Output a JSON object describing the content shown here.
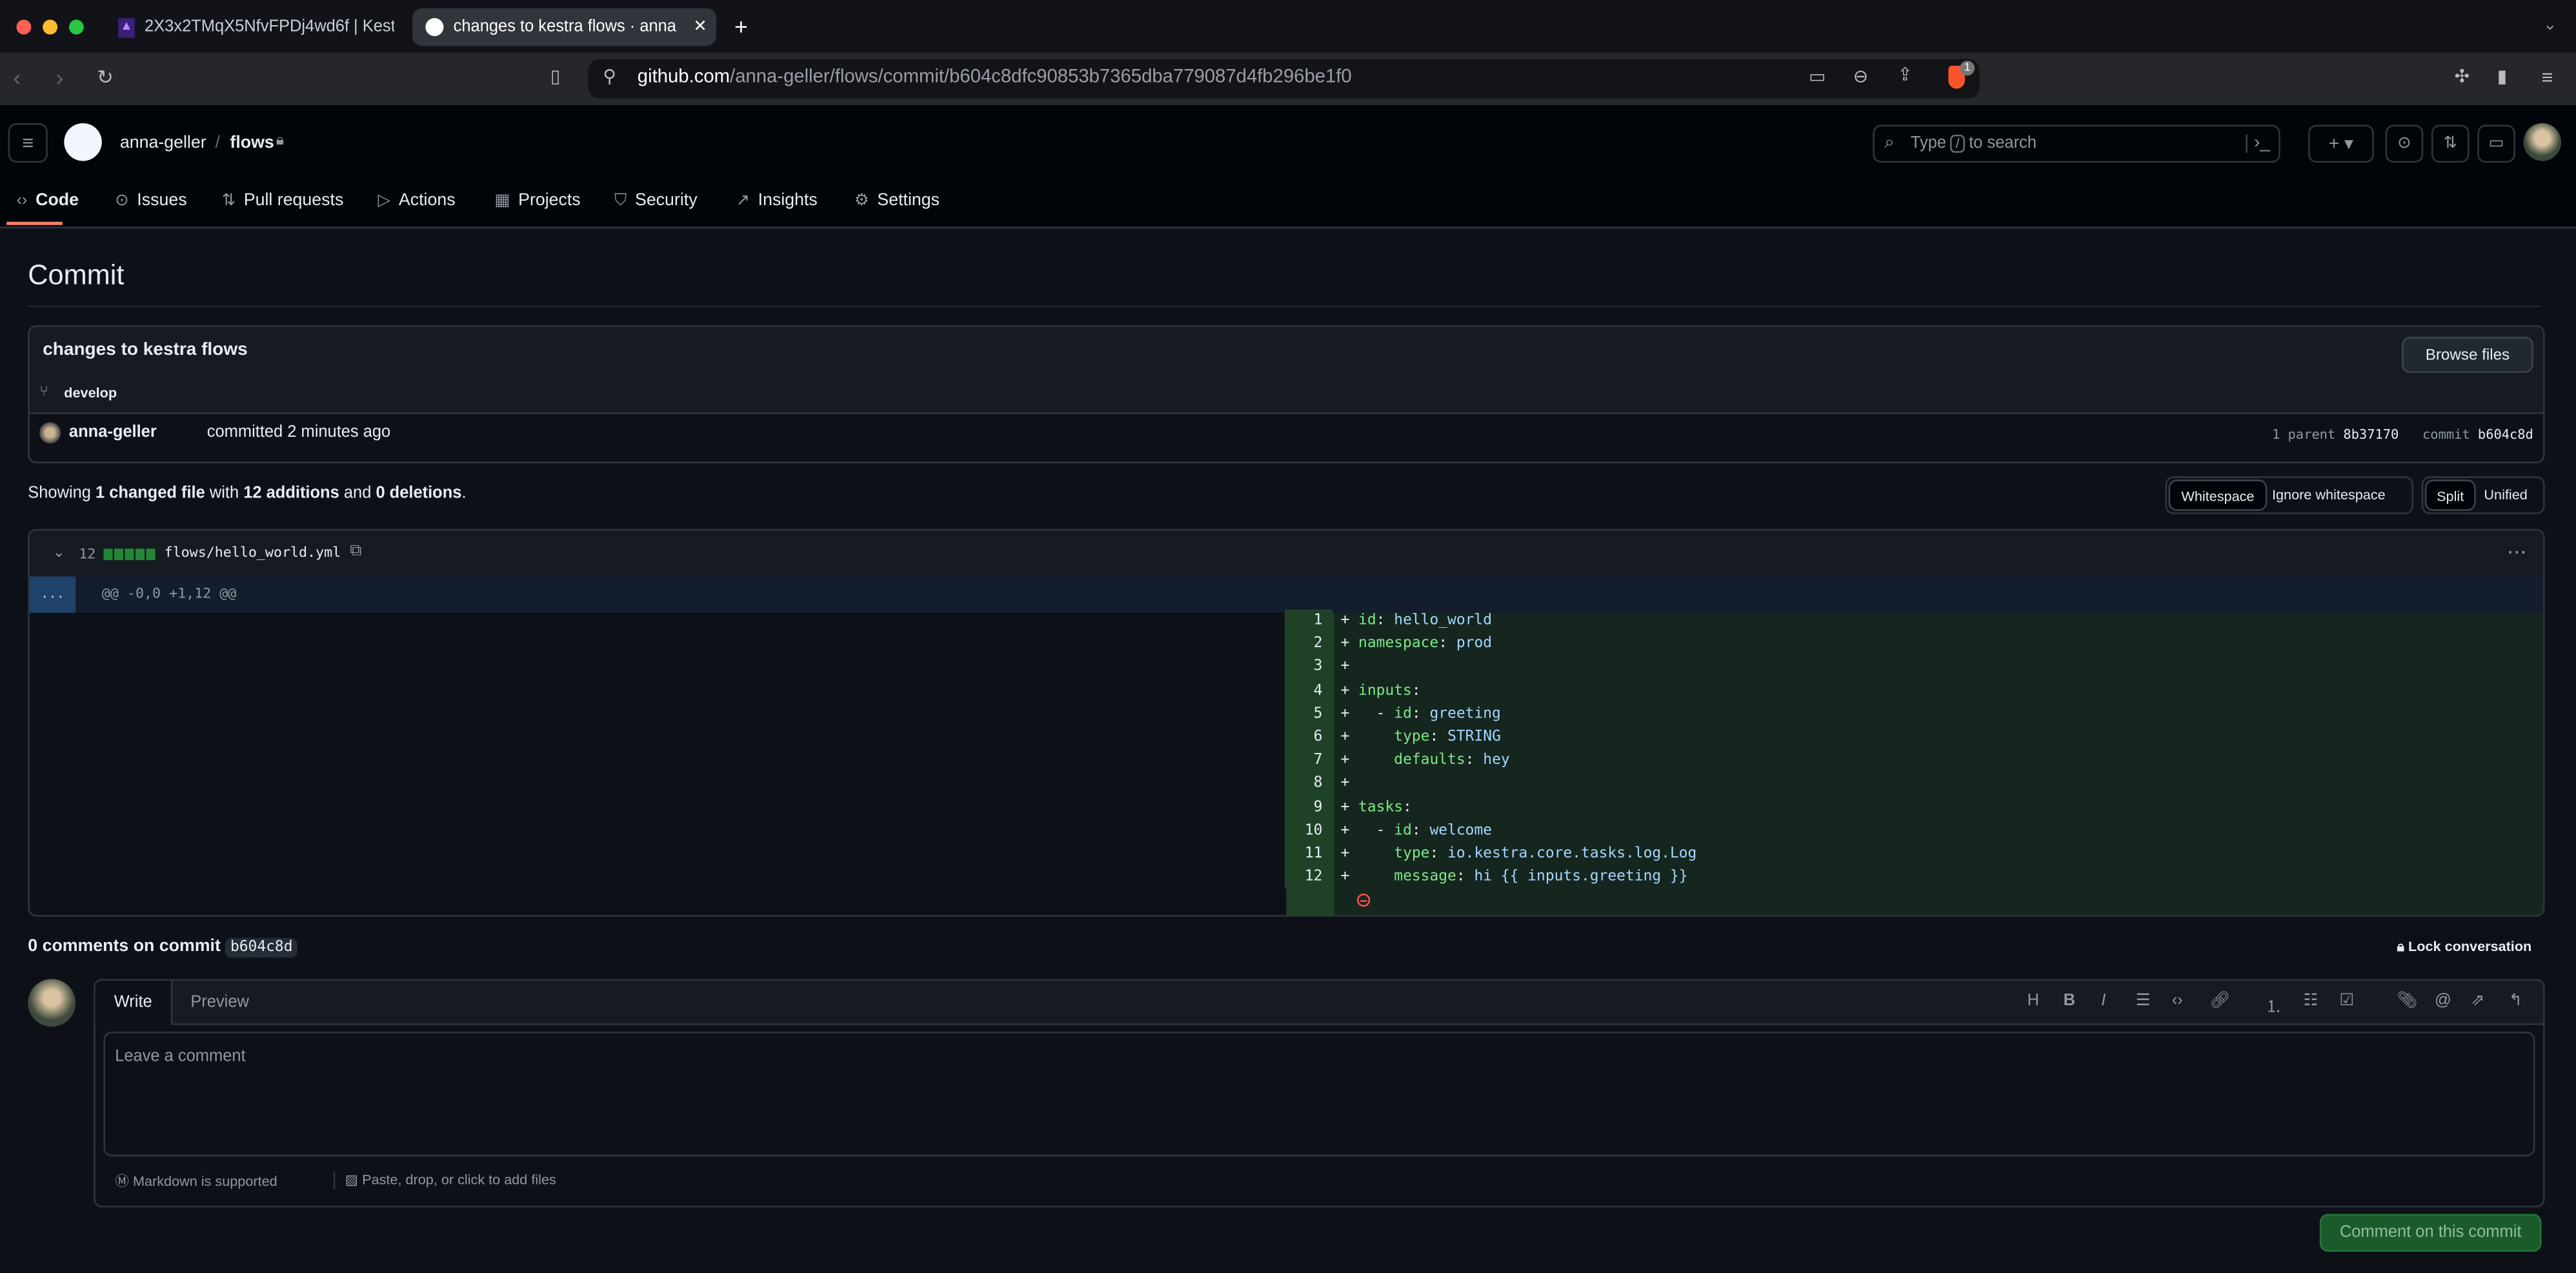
{
  "browser": {
    "tabs": [
      {
        "title": "2X3x2TMqX5NfvFPDj4wd6f | Kest",
        "active": false
      },
      {
        "title": "changes to kestra flows · anna",
        "active": true
      }
    ],
    "url_host": "github.com",
    "url_path": "/anna-geller/flows/commit/b604c8dfc90853b7365dba779087d4fb296be1f0",
    "shield_badge": "1"
  },
  "header": {
    "owner": "anna-geller",
    "separator": "/",
    "repo": "flows",
    "search_placeholder_pre": "Type",
    "search_key": "/",
    "search_placeholder_post": "to search"
  },
  "nav": [
    {
      "label": "Code",
      "icon": "code-icon",
      "active": true
    },
    {
      "label": "Issues",
      "icon": "issue-icon"
    },
    {
      "label": "Pull requests",
      "icon": "pull-request-icon"
    },
    {
      "label": "Actions",
      "icon": "play-icon"
    },
    {
      "label": "Projects",
      "icon": "table-icon"
    },
    {
      "label": "Security",
      "icon": "shield-icon"
    },
    {
      "label": "Insights",
      "icon": "graph-icon"
    },
    {
      "label": "Settings",
      "icon": "gear-icon"
    }
  ],
  "page": {
    "title": "Commit"
  },
  "commit": {
    "message": "changes to kestra flows",
    "branch": "develop",
    "browse_files": "Browse files",
    "author": "anna-geller",
    "committed_text": "committed 2 minutes ago",
    "parent_label": "1 parent",
    "parent_sha": "8b37170",
    "commit_label": "commit",
    "commit_sha": "b604c8d"
  },
  "summary": {
    "p1": "Showing ",
    "files": "1 changed file",
    "p2": " with ",
    "additions": "12 additions",
    "p3": " and ",
    "deletions": "0 deletions",
    "p4": "."
  },
  "view_options": {
    "whitespace": "Whitespace",
    "ignore_whitespace": "Ignore whitespace",
    "split": "Split",
    "unified": "Unified"
  },
  "file": {
    "changes": "12",
    "path": "flows/hello_world.yml",
    "hunk_expand": "...",
    "hunk": "@@ -0,0 +1,12 @@",
    "lines": [
      {
        "n": "1",
        "k": "id",
        "s": ": ",
        "v": "hello_world",
        "ind": ""
      },
      {
        "n": "2",
        "k": "namespace",
        "s": ": ",
        "v": "prod",
        "ind": ""
      },
      {
        "n": "3",
        "k": "",
        "s": "",
        "v": "",
        "ind": ""
      },
      {
        "n": "4",
        "k": "inputs",
        "s": ":",
        "v": "",
        "ind": ""
      },
      {
        "n": "5",
        "k": "id",
        "s": ": ",
        "v": "greeting",
        "ind": "  - "
      },
      {
        "n": "6",
        "k": "type",
        "s": ": ",
        "v": "STRING",
        "ind": "    "
      },
      {
        "n": "7",
        "k": "defaults",
        "s": ": ",
        "v": "hey",
        "ind": "    "
      },
      {
        "n": "8",
        "k": "",
        "s": "",
        "v": "",
        "ind": ""
      },
      {
        "n": "9",
        "k": "tasks",
        "s": ":",
        "v": "",
        "ind": ""
      },
      {
        "n": "10",
        "k": "id",
        "s": ": ",
        "v": "welcome",
        "ind": "  - "
      },
      {
        "n": "11",
        "k": "type",
        "s": ": ",
        "v": "io.kestra.core.tasks.log.Log",
        "ind": "    "
      },
      {
        "n": "12",
        "k": "message",
        "s": ": ",
        "v": "hi {{ inputs.greeting }}",
        "ind": "    "
      }
    ]
  },
  "comments": {
    "heading": "0 comments on commit",
    "sha": "b604c8d",
    "lock": "Lock conversation",
    "tab_write": "Write",
    "tab_preview": "Preview",
    "placeholder": "Leave a comment",
    "markdown": "Markdown is supported",
    "attach": "Paste, drop, or click to add files",
    "submit": "Comment on this commit"
  },
  "colors": {
    "accent_underline": "#f78166",
    "add_bg": "#15261f",
    "add_num_bg": "#1f4227",
    "submit_bg": "#1a5b2c"
  }
}
